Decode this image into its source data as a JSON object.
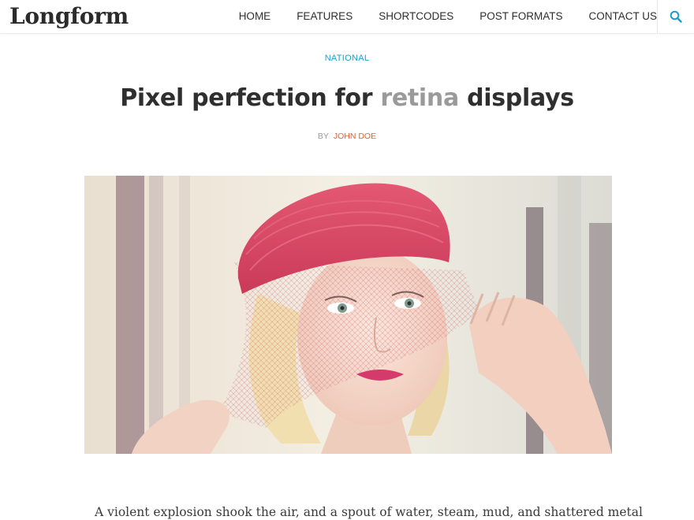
{
  "site": {
    "logo": "Longform"
  },
  "nav": {
    "items": [
      {
        "label": "HOME"
      },
      {
        "label": "FEATURES"
      },
      {
        "label": "SHORTCODES"
      },
      {
        "label": "POST FORMATS"
      },
      {
        "label": "CONTACT US"
      }
    ],
    "search_icon": "search-icon",
    "accent_color": "#1a9fc9"
  },
  "post": {
    "category": "NATIONAL",
    "title_before": "Pixel perfection for ",
    "title_highlight": "retina",
    "title_after": " displays",
    "by_label": "BY",
    "author": "JOHN DOE",
    "author_color": "#e8612c",
    "featured_image": "photo-woman-pink-hat",
    "body_first_line": "A violent explosion shook the air, and a spout of water, steam, mud, and shattered metal"
  }
}
